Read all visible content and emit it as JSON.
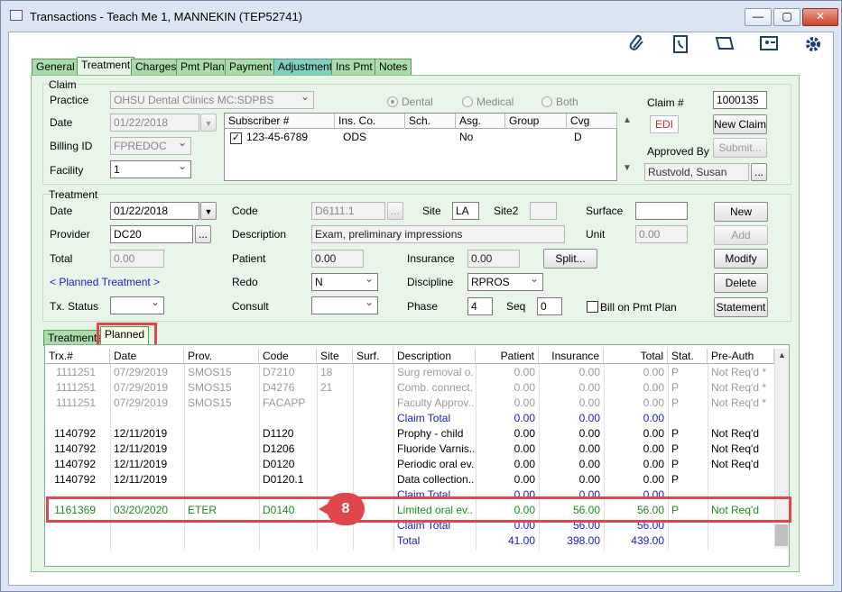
{
  "window": {
    "title": "Transactions - Teach Me 1, MANNEKIN (TEP52741)",
    "minimize": "—",
    "maximize": "▢",
    "close": "✕"
  },
  "toolbar": {
    "icons": [
      "paperclip-icon",
      "phone-book-icon",
      "book-icon",
      "contact-card-icon",
      "gear-icon"
    ]
  },
  "tabs": [
    "General",
    "Treatment",
    "Charges",
    "Pmt Plan",
    "Payment",
    "Adjustment",
    "Ins Pmt",
    "Notes"
  ],
  "claim": {
    "group_label": "Claim",
    "practice_label": "Practice",
    "practice_value": "OHSU Dental Clinics MC:SDPBS",
    "date_label": "Date",
    "date_value": "01/22/2018",
    "billing_label": "Billing ID",
    "billing_value": "FPREDOC",
    "facility_label": "Facility",
    "facility_value": "1",
    "radio_dental": "Dental",
    "radio_medical": "Medical",
    "radio_both": "Both",
    "claim_no_label": "Claim #",
    "claim_no_value": "1000135",
    "edi": "EDI",
    "new_claim": "New Claim",
    "approved_by_label": "Approved By",
    "submit": "Submit...",
    "approved_by_value": "Rustvold, Susan",
    "ellipsis": "...",
    "sub_headers": [
      "Subscriber #",
      "Ins. Co.",
      "Sch.",
      "Asg.",
      "Group",
      "Cvg"
    ],
    "sub_row": {
      "subscriber": "123-45-6789",
      "ins_co": "ODS",
      "sch": "",
      "asg": "No",
      "group": "",
      "cvg": "D"
    }
  },
  "treatment": {
    "group_label": "Treatment",
    "date_label": "Date",
    "date_value": "01/22/2018",
    "code_label": "Code",
    "code_value": "D6111.1",
    "site_label": "Site",
    "site_value": "LA",
    "site2_label": "Site2",
    "site2_value": "",
    "surface_label": "Surface",
    "surface_value": "",
    "new": "New",
    "provider_label": "Provider",
    "provider_value": "DC20",
    "description_label": "Description",
    "description_value": "Exam, preliminary impressions",
    "unit_label": "Unit",
    "unit_value": "0.00",
    "add": "Add",
    "total_label": "Total",
    "total_value": "0.00",
    "patient_label": "Patient",
    "patient_value": "0.00",
    "insurance_label": "Insurance",
    "insurance_value": "0.00",
    "split": "Split...",
    "modify": "Modify",
    "planned_link": "< Planned Treatment >",
    "redo_label": "Redo",
    "redo_value": "N",
    "discipline_label": "Discipline",
    "discipline_value": "RPROS",
    "delete": "Delete",
    "txstatus_label": "Tx. Status",
    "txstatus_value": "",
    "consult_label": "Consult",
    "consult_value": "",
    "phase_label": "Phase",
    "phase_value": "4",
    "seq_label": "Seq",
    "seq_value": "0",
    "bill_on_pmt_plan": "Bill on Pmt Plan",
    "statement": "Statement"
  },
  "subtabs": [
    "Treatments",
    "Planned"
  ],
  "grid": {
    "headers": [
      "Trx.#",
      "Date",
      "Prov.",
      "Code",
      "Site",
      "Surf.",
      "Description",
      "Patient",
      "Insurance",
      "Total",
      "Stat.",
      "Pre-Auth"
    ],
    "rows": [
      {
        "style": "gray",
        "cells": [
          "1111251",
          "07/29/2019",
          "SMOS15",
          "D7210",
          "18",
          "",
          "Surg removal o...",
          "0.00",
          "0.00",
          "0.00",
          "P",
          "Not Req'd *"
        ]
      },
      {
        "style": "gray",
        "cells": [
          "1111251",
          "07/29/2019",
          "SMOS15",
          "D4276",
          "21",
          "",
          "Comb. connect...",
          "0.00",
          "0.00",
          "0.00",
          "P",
          "Not Req'd *"
        ]
      },
      {
        "style": "gray",
        "cells": [
          "1111251",
          "07/29/2019",
          "SMOS15",
          "FACAPP",
          "",
          "",
          "Faculty Approv...",
          "0.00",
          "0.00",
          "0.00",
          "P",
          "Not Req'd *"
        ]
      },
      {
        "style": "blue",
        "cells": [
          "",
          "",
          "",
          "",
          "",
          "",
          "Claim Total",
          "0.00",
          "0.00",
          "0.00",
          "",
          ""
        ]
      },
      {
        "style": "black",
        "cells": [
          "1140792",
          "12/11/2019",
          "",
          "D1120",
          "",
          "",
          "Prophy - child",
          "0.00",
          "0.00",
          "0.00",
          "P",
          "Not Req'd"
        ]
      },
      {
        "style": "black",
        "cells": [
          "1140792",
          "12/11/2019",
          "",
          "D1206",
          "",
          "",
          "Fluoride Varnis...",
          "0.00",
          "0.00",
          "0.00",
          "P",
          "Not Req'd"
        ]
      },
      {
        "style": "black",
        "cells": [
          "1140792",
          "12/11/2019",
          "",
          "D0120",
          "",
          "",
          "Periodic oral ev...",
          "0.00",
          "0.00",
          "0.00",
          "P",
          "Not Req'd"
        ]
      },
      {
        "style": "black",
        "cells": [
          "1140792",
          "12/11/2019",
          "",
          "D0120.1",
          "",
          "",
          "Data collection...",
          "0.00",
          "0.00",
          "0.00",
          "P",
          ""
        ]
      },
      {
        "style": "blue",
        "cells": [
          "",
          "",
          "",
          "",
          "",
          "",
          "Claim Total",
          "0.00",
          "0.00",
          "0.00",
          "",
          ""
        ]
      },
      {
        "style": "green",
        "cells": [
          "1161369",
          "03/20/2020",
          "ETER",
          "D0140",
          "",
          "",
          "Limited oral ev...",
          "0.00",
          "56.00",
          "56.00",
          "P",
          "Not Req'd"
        ]
      },
      {
        "style": "blue",
        "cells": [
          "",
          "",
          "",
          "",
          "",
          "",
          "Claim Total",
          "0.00",
          "56.00",
          "56.00",
          "",
          ""
        ]
      },
      {
        "style": "blue",
        "cells": [
          "",
          "",
          "",
          "",
          "",
          "",
          "Total",
          "41.00",
          "398.00",
          "439.00",
          "",
          ""
        ]
      }
    ]
  },
  "callout": {
    "number": "8"
  },
  "colors": {
    "accent_red": "#e0474c",
    "gray_text": "#9a9a9a",
    "blue_text": "#1b1bc8",
    "green_text": "#1f8a1f"
  }
}
